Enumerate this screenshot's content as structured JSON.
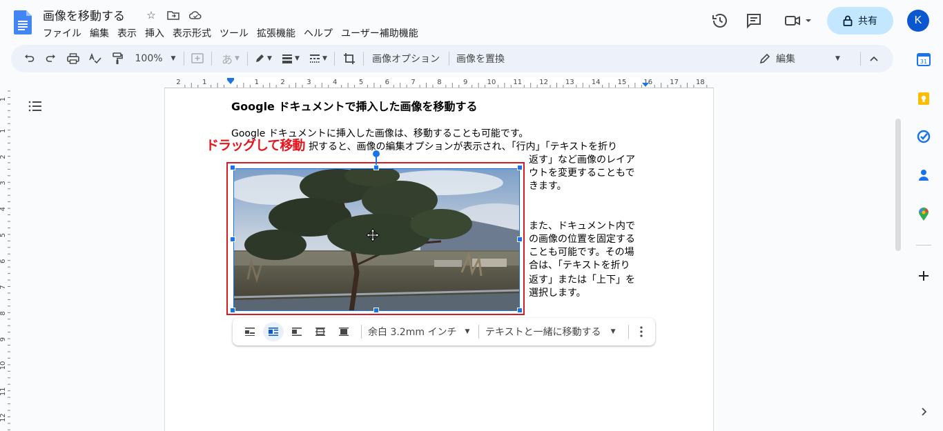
{
  "header": {
    "doc_title": "画像を移動する",
    "menu": [
      "ファイル",
      "編集",
      "表示",
      "挿入",
      "表示形式",
      "ツール",
      "拡張機能",
      "ヘルプ",
      "ユーザー補助機能"
    ],
    "share_label": "共有",
    "avatar_initial": "K"
  },
  "toolbar": {
    "zoom": "100%",
    "ime_char": "あ",
    "image_options": "画像オプション",
    "replace_image": "画像を置換",
    "mode_label": "編集"
  },
  "ruler": {
    "h_labels": [
      "2",
      "1",
      "1",
      "2",
      "3",
      "4",
      "5",
      "6",
      "7",
      "8",
      "9",
      "10",
      "11",
      "12",
      "13",
      "14",
      "15",
      "16",
      "17",
      "18"
    ],
    "v_labels": [
      "1",
      "1",
      "2",
      "3",
      "4",
      "5",
      "6",
      "7",
      "8",
      "9",
      "10",
      "11",
      "12"
    ]
  },
  "document": {
    "heading": "Google ドキュメントで挿入した画像を移動する",
    "para1": "Google ドキュメントに挿入した画像は、移動することも可能です。",
    "para2_visible": "択すると、画像の編集オプションが表示され、「行内」「テキストを折り",
    "wrap_lines_1": [
      "返す」など画像のレイア",
      "ウトを変更することもで",
      "きます。"
    ],
    "wrap_lines_2": [
      "また、ドキュメント内で",
      "の画像の位置を固定する",
      "ことも可能です。その場",
      "合は、「テキストを折り",
      "返す」または「上下」を",
      "選択します。"
    ]
  },
  "annotation": {
    "drag_label": "ドラッグして移動",
    "color": "#e8141c"
  },
  "image_bar": {
    "margin_label": "余白 3.2mm インチ",
    "position_label": "テキストと一緒に移動する"
  },
  "colors": {
    "accent": "#1a73e8",
    "share_bg": "#c2e7ff",
    "toolbar_bg": "#edf2fa",
    "annotation_frame": "#d81b22"
  }
}
